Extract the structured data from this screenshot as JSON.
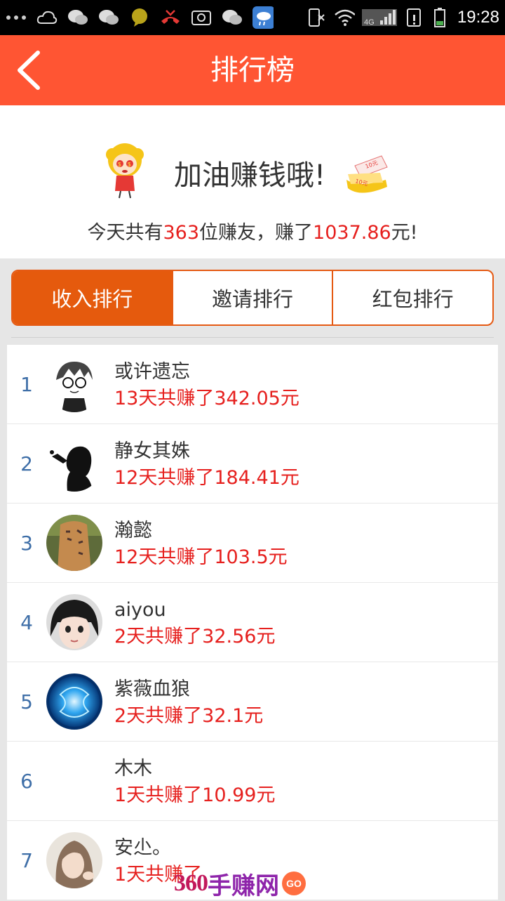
{
  "status_bar": {
    "time": "19:28",
    "network": "4G",
    "icons": [
      "more-dots-icon",
      "cloud-icon",
      "wechat-icon",
      "wechat-icon",
      "chat-bubble-icon",
      "missed-call-icon",
      "screenshot-icon",
      "wechat-icon",
      "weather-icon",
      "silent-icon",
      "wifi-icon",
      "signal-icon",
      "sim-alert-icon",
      "battery-icon"
    ]
  },
  "title_bar": {
    "title": "排行榜",
    "back_icon": "chevron-left-icon",
    "color": "#ff5533"
  },
  "header": {
    "slogan": "加油赚钱哦!",
    "summary_prefix": "今天共有",
    "user_count": "363",
    "summary_mid": "位赚友，赚了",
    "total_amount": "1037.86",
    "summary_suffix": "元!",
    "coupon_text_1": "10元",
    "coupon_text_2": "10元"
  },
  "tabs": [
    {
      "label": "收入排行",
      "active": true
    },
    {
      "label": "邀请排行",
      "active": false
    },
    {
      "label": "红包排行",
      "active": false
    }
  ],
  "ranking": [
    {
      "rank": "1",
      "name": "或许遗忘",
      "earnings": "13天共赚了342.05元"
    },
    {
      "rank": "2",
      "name": "静女其姝",
      "earnings": "12天共赚了184.41元"
    },
    {
      "rank": "3",
      "name": "瀚懿",
      "earnings": "12天共赚了103.5元"
    },
    {
      "rank": "4",
      "name": "aiyou",
      "earnings": "2天共赚了32.56元"
    },
    {
      "rank": "5",
      "name": "紫薇血狼",
      "earnings": "2天共赚了32.1元"
    },
    {
      "rank": "6",
      "name": "木木",
      "earnings": "1天共赚了10.99元"
    },
    {
      "rank": "7",
      "name": "安尐。",
      "earnings": "1天共赚了"
    }
  ],
  "watermark": {
    "number": "360",
    "text": "手赚网",
    "badge": "GO"
  },
  "colors": {
    "accent": "#e55a0d",
    "highlight": "#e6201e",
    "rank": "#3f6fa8"
  }
}
